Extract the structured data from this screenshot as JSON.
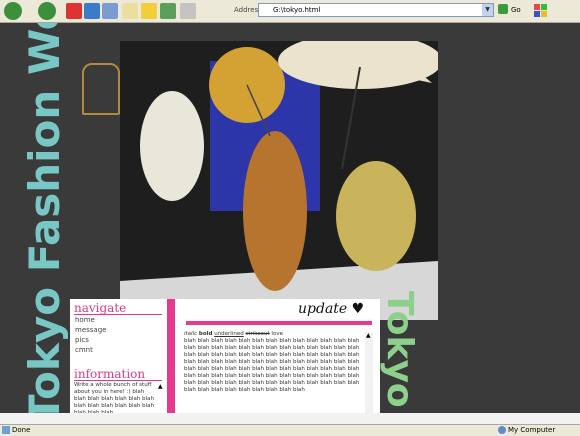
{
  "browser": {
    "address_label": "Address",
    "address_value": "G:\\tokyo.html",
    "go_label": "Go",
    "status_left": "Done",
    "status_right": "My Computer"
  },
  "decor": {
    "left_vertical": "Tokyo Fashion Week",
    "right_vertical": "Tokyo"
  },
  "navigate": {
    "heading": "navigate",
    "items": [
      "home",
      "message",
      "pics",
      "cmnt"
    ]
  },
  "information": {
    "heading": "information",
    "text": "Write a whole bunch of stuff about you in here! :) blah blah blah blah blah blah blah blah blah blah blah blah blah blah blah blah"
  },
  "update": {
    "title": "update",
    "line_prefix": "italic",
    "bold": "bold",
    "underlined": "underlined",
    "strike": "strikeout",
    "love": "love",
    "body": "blah blah blah blah blah blah blah blah blah blah blah blah blah blah blah blah blah blah blah blah blah blah blah blah blah blah blah blah blah blah blah blah blah blah blah blah blah blah blah blah blah blah blah blah blah blah blah blah blah blah blah blah blah blah blah blah blah blah blah blah blah blah blah blah blah blah blah blah blah blah blah blah blah blah blah blah blah blah blah blah blah blah blah blah blah blah blah blah blah blah blah blah blah blah blah blah blah blah blah blah"
  },
  "colors": {
    "accent": "#e83a8c",
    "teal": "#79c7c4",
    "green": "#8cd08c"
  }
}
